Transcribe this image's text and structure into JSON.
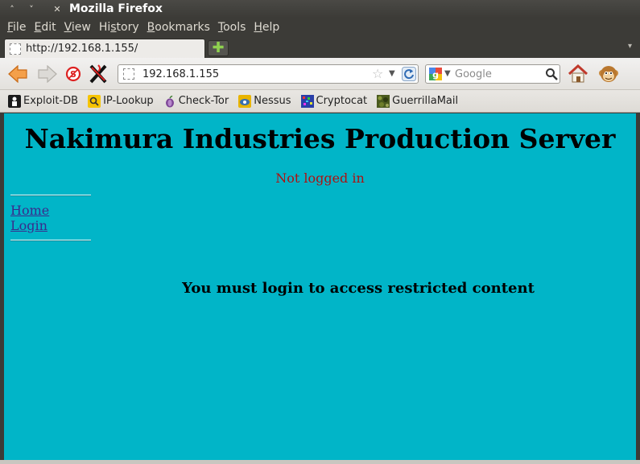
{
  "window": {
    "title": "Mozilla Firefox"
  },
  "menu": [
    "File",
    "Edit",
    "View",
    "History",
    "Bookmarks",
    "Tools",
    "Help"
  ],
  "menu_underline": [
    "F",
    "E",
    "V",
    "s",
    "B",
    "T",
    "H"
  ],
  "tab": {
    "label": "http://192.168.1.155/"
  },
  "url": {
    "value": "192.168.1.155"
  },
  "search": {
    "placeholder": "Google"
  },
  "bookmarks": [
    {
      "label": "Exploit-DB",
      "icon": "exploit-db-icon"
    },
    {
      "label": "IP-Lookup",
      "icon": "ip-lookup-icon"
    },
    {
      "label": "Check-Tor",
      "icon": "tor-onion-icon"
    },
    {
      "label": "Nessus",
      "icon": "nessus-icon"
    },
    {
      "label": "Cryptocat",
      "icon": "cryptocat-icon"
    },
    {
      "label": "GuerrillaMail",
      "icon": "guerrillamail-icon"
    }
  ],
  "page": {
    "title": "Nakimura Industries Production Server",
    "login_status": "Not logged in",
    "links": [
      "Home",
      "Login"
    ],
    "message": "You must login to access restricted content",
    "background": "#01b5c8"
  }
}
